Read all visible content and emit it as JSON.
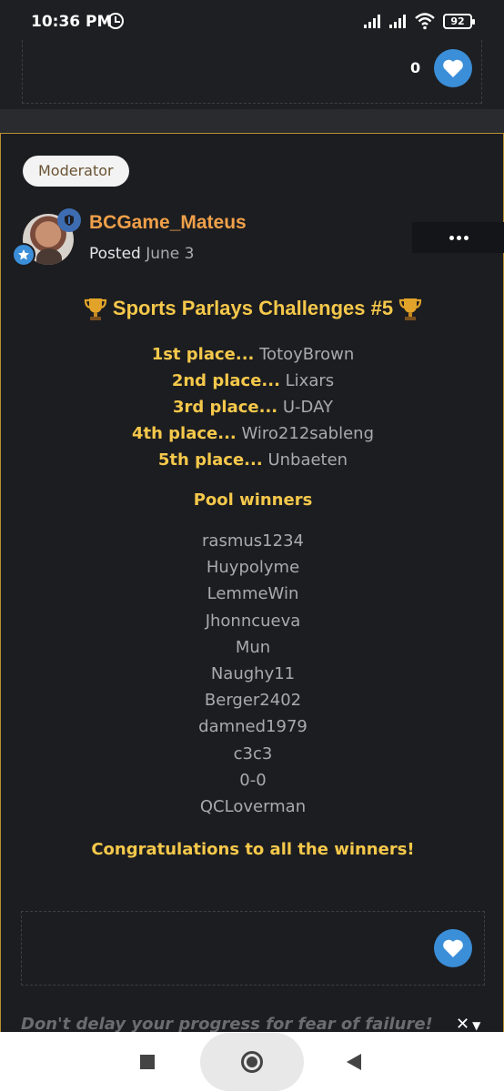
{
  "status_bar": {
    "time": "10:36 PM",
    "battery": "92"
  },
  "previous_post": {
    "like_count": "0"
  },
  "post": {
    "role_badge": "Moderator",
    "author": "BCGame_Mateus",
    "posted_label": "Posted",
    "posted_date": "June 3",
    "title": "Sports Parlays Challenges #5",
    "places": [
      {
        "rank": "1st place...",
        "name": "TotoyBrown"
      },
      {
        "rank": "2nd place...",
        "name": "Lixars"
      },
      {
        "rank": "3rd place...",
        "name": "U-DAY"
      },
      {
        "rank": "4th place...",
        "name": "Wiro212sableng"
      },
      {
        "rank": "5th place...",
        "name": "Unbaeten"
      }
    ],
    "pool_title": "Pool winners",
    "pool_winners": [
      "rasmus1234",
      "Huypolyme",
      "LemmeWin",
      "Jhonncueva",
      "Mun",
      "Naughy11",
      "Berger2402",
      "damned1979",
      "c3c3",
      "0-0",
      "QCLoverman"
    ],
    "congrats": "Congratulations to all the winners!",
    "signature": "Don't delay your progress for fear of failure!"
  },
  "colors": {
    "accent_gold": "#f5c84b",
    "author_orange": "#f0a04a",
    "like_blue": "#3b8ed8",
    "border_gold": "#b8902f"
  },
  "icons": [
    "alarm-icon",
    "signal-icon",
    "wifi-icon",
    "battery-icon",
    "heart-icon",
    "shield-icon",
    "star-icon",
    "trophy-icon",
    "more-icon",
    "close-icon",
    "chevron-down-icon",
    "recents-icon",
    "home-icon",
    "back-icon"
  ]
}
